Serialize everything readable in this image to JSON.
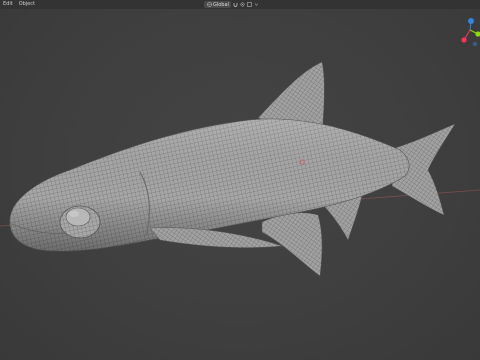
{
  "header": {
    "menu_items": [
      "Edit",
      "Object"
    ],
    "shading_mode": "Global",
    "mode_icons": [
      "select-icon",
      "cursor-icon",
      "move-icon"
    ],
    "snap_icons": [
      "magnet-icon",
      "proportional-icon",
      "overlay-icon"
    ]
  },
  "gizmo": {
    "axes": [
      {
        "label": "Z",
        "color": "#2f83e3"
      },
      {
        "label": "Y",
        "color": "#8bdc00"
      },
      {
        "label": "X",
        "color": "#ff3352"
      }
    ]
  },
  "viewport": {
    "background": "#3d3d3d",
    "grid_axis_color": "#7a4e4e",
    "object": "fish-mesh"
  }
}
